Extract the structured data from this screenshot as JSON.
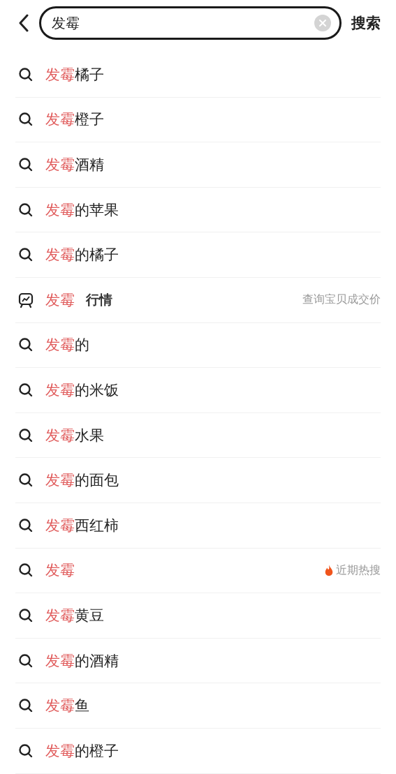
{
  "search": {
    "value": "发霉",
    "submit": "搜索"
  },
  "suggestions": [
    {
      "kind": "query",
      "match": "发霉",
      "rest": "橘子"
    },
    {
      "kind": "query",
      "match": "发霉",
      "rest": "橙子"
    },
    {
      "kind": "query",
      "match": "发霉",
      "rest": "酒精"
    },
    {
      "kind": "query",
      "match": "发霉",
      "rest": "的苹果"
    },
    {
      "kind": "query",
      "match": "发霉",
      "rest": "的橘子"
    },
    {
      "kind": "market",
      "match": "发霉",
      "tag": "行情",
      "hint": "查询宝贝成交价"
    },
    {
      "kind": "query",
      "match": "发霉",
      "rest": "的"
    },
    {
      "kind": "query",
      "match": "发霉",
      "rest": "的米饭"
    },
    {
      "kind": "query",
      "match": "发霉",
      "rest": "水果"
    },
    {
      "kind": "query",
      "match": "发霉",
      "rest": "的面包"
    },
    {
      "kind": "query",
      "match": "发霉",
      "rest": "西红柿"
    },
    {
      "kind": "hot",
      "match": "发霉",
      "hint": "近期热搜"
    },
    {
      "kind": "query",
      "match": "发霉",
      "rest": "黄豆"
    },
    {
      "kind": "query",
      "match": "发霉",
      "rest": "的酒精"
    },
    {
      "kind": "query",
      "match": "发霉",
      "rest": "鱼"
    },
    {
      "kind": "query",
      "match": "发霉",
      "rest": "的橙子"
    }
  ]
}
